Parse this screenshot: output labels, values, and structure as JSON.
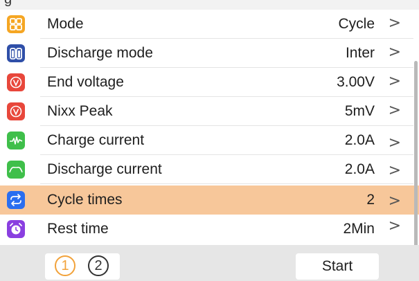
{
  "header": {
    "title_fragment": "g"
  },
  "rows": [
    {
      "label": "Mode",
      "value": "Cycle",
      "icon": "grid-icon",
      "color": "#f5a623"
    },
    {
      "label": "Discharge mode",
      "value": "Inter",
      "icon": "battery-pair-icon",
      "color": "#2f4fa8"
    },
    {
      "label": "End voltage",
      "value": "3.00V",
      "icon": "voltage-icon",
      "color": "#e8473b"
    },
    {
      "label": "Nixx Peak",
      "value": "5mV",
      "icon": "voltage-icon",
      "color": "#e8473b"
    },
    {
      "label": "Charge current",
      "value": "2.0A",
      "icon": "pulse-icon",
      "color": "#3fbf4a"
    },
    {
      "label": "Discharge current",
      "value": "2.0A",
      "icon": "curve-icon",
      "color": "#3fbf4a"
    },
    {
      "label": "Cycle times",
      "value": "2",
      "icon": "cycle-icon",
      "color": "#2a6ef0",
      "selected": true
    },
    {
      "label": "Rest time",
      "value": "2Min",
      "icon": "alarm-clock-icon",
      "color": "#8a3fe0"
    }
  ],
  "chevron": ">",
  "footer": {
    "page_1": "1",
    "page_2": "2",
    "start_label": "Start"
  },
  "colors": {
    "selected_row": "#f7c79a",
    "active_page": "#f2a23a",
    "footer_bg": "#e6e6e6"
  }
}
